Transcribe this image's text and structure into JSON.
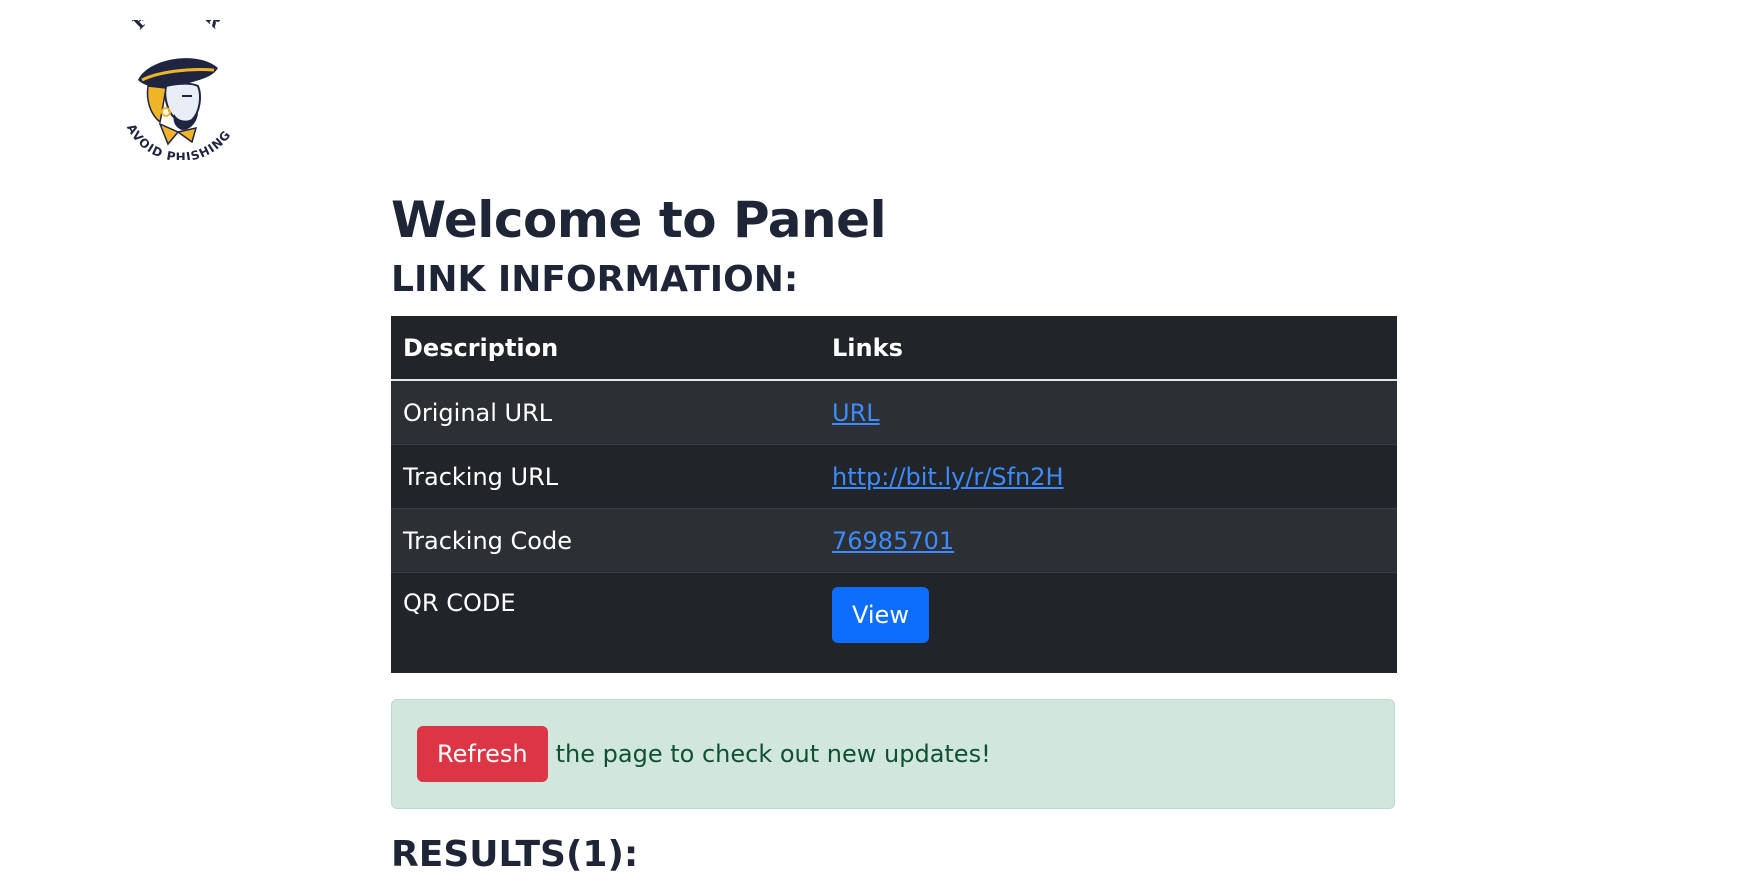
{
  "logo": {
    "top_text": "FISHER",
    "bottom_text": "AVOID PHISHING"
  },
  "main": {
    "title": "Welcome to Panel",
    "link_section_title": "LINK INFORMATION:",
    "table": {
      "headers": [
        "Description",
        "Links"
      ],
      "rows": [
        {
          "description": "Original URL",
          "link": "URL"
        },
        {
          "description": "Tracking URL",
          "link": "http://bit.ly/r/Sfn2H"
        },
        {
          "description": "Tracking Code",
          "link": "76985701"
        },
        {
          "description": "QR CODE",
          "button": "View"
        }
      ]
    },
    "alert": {
      "button_label": "Refresh",
      "text": "the page to check out new updates!"
    },
    "results_title": "RESULTS(1):"
  },
  "colors": {
    "table_bg": "#212529",
    "link": "#3d8bfd",
    "primary_button": "#0d6efd",
    "danger_button": "#dc3545",
    "alert_bg": "#d1e7dd",
    "alert_text": "#0f5132",
    "heading": "#1e2536"
  }
}
